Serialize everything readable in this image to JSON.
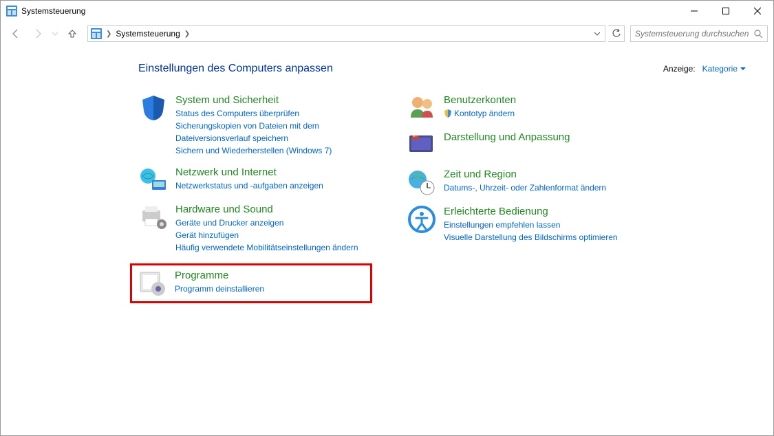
{
  "window": {
    "title": "Systemsteuerung"
  },
  "breadcrumb": {
    "root": "Systemsteuerung"
  },
  "search": {
    "placeholder": "Systemsteuerung durchsuchen"
  },
  "header": {
    "title": "Einstellungen des Computers anpassen",
    "view_label": "Anzeige:",
    "view_value": "Kategorie"
  },
  "categories": {
    "system_security": {
      "title": "System und Sicherheit",
      "links": [
        "Status des Computers überprüfen",
        "Sicherungskopien von Dateien mit dem Dateiversionsverlauf speichern",
        "Sichern und Wiederherstellen (Windows 7)"
      ]
    },
    "network": {
      "title": "Netzwerk und Internet",
      "links": [
        "Netzwerkstatus und -aufgaben anzeigen"
      ]
    },
    "hardware": {
      "title": "Hardware und Sound",
      "links": [
        "Geräte und Drucker anzeigen",
        "Gerät hinzufügen",
        "Häufig verwendete Mobilitätseinstellungen ändern"
      ]
    },
    "programs": {
      "title": "Programme",
      "links": [
        "Programm deinstallieren"
      ]
    },
    "user_accounts": {
      "title": "Benutzerkonten",
      "links": [
        "Kontotyp ändern"
      ]
    },
    "appearance": {
      "title": "Darstellung und Anpassung"
    },
    "time_region": {
      "title": "Zeit und Region",
      "links": [
        "Datums-, Uhrzeit- oder Zahlenformat ändern"
      ]
    },
    "ease_of_access": {
      "title": "Erleichterte Bedienung",
      "links": [
        "Einstellungen empfehlen lassen",
        "Visuelle Darstellung des Bildschirms optimieren"
      ]
    }
  }
}
